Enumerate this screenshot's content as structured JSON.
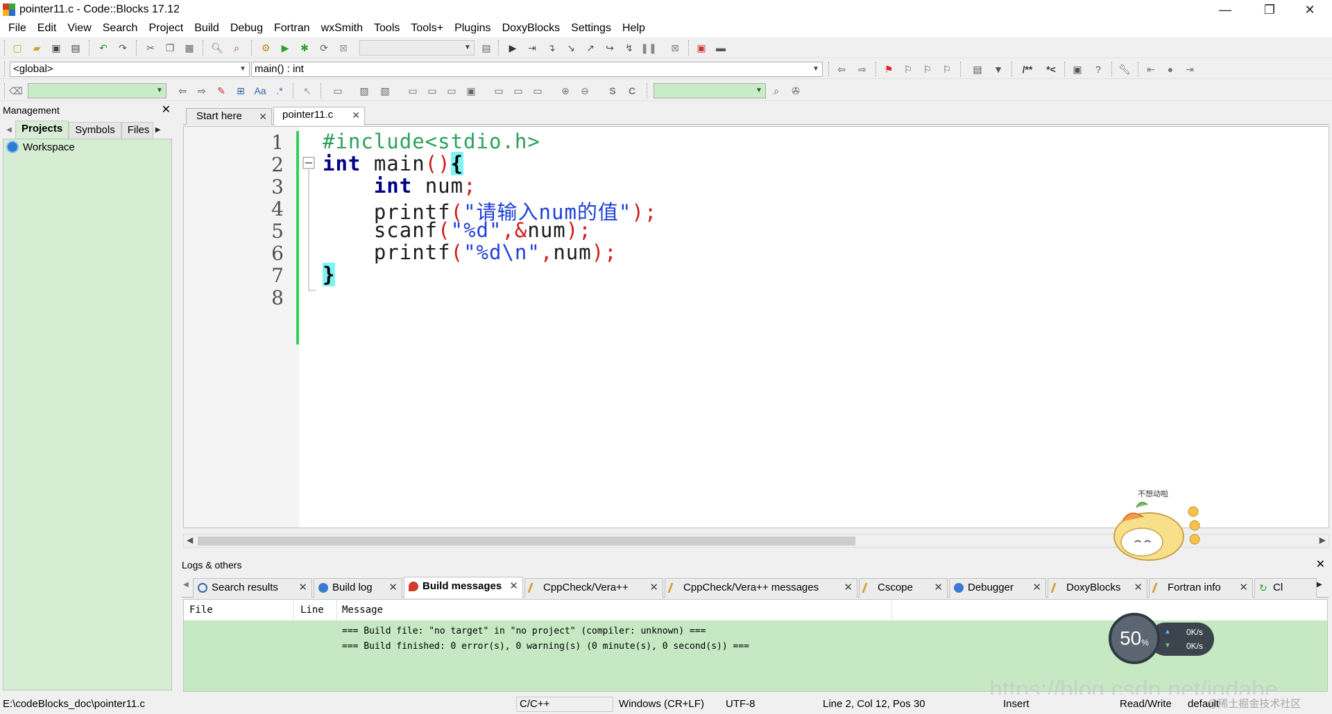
{
  "window": {
    "title": "pointer11.c - Code::Blocks 17.12",
    "controls": {
      "minimize": "—",
      "restore": "❐",
      "close": "✕"
    }
  },
  "menu": [
    "File",
    "Edit",
    "View",
    "Search",
    "Project",
    "Build",
    "Debug",
    "Fortran",
    "wxSmith",
    "Tools",
    "Tools+",
    "Plugins",
    "DoxyBlocks",
    "Settings",
    "Help"
  ],
  "toolbar": {
    "scope_combo": "<global>",
    "function_combo": "main() : int"
  },
  "management": {
    "title": "Management",
    "tabs": [
      "Projects",
      "Symbols",
      "Files"
    ],
    "active_tab": "Projects",
    "tree": [
      "Workspace"
    ]
  },
  "editor": {
    "tabs": [
      {
        "label": "Start here",
        "active": false
      },
      {
        "label": "pointer11.c",
        "active": true
      }
    ],
    "line_numbers": [
      "1",
      "2",
      "3",
      "4",
      "5",
      "6",
      "7",
      "8"
    ],
    "code": {
      "l1": "#include<stdio.h>",
      "l2_kw": "int",
      "l2_id": " main",
      "l2_paren": "()",
      "l2_brace": "{",
      "l3_kw": "int",
      "l3_id": " num",
      "l3_semi": ";",
      "l4_fn": "printf",
      "l4_open": "(",
      "l4_str": "\"请输入num的值\"",
      "l4_close": ");",
      "l5_fn": "scanf",
      "l5_open": "(",
      "l5_str": "\"%d\"",
      "l5_mid": ",&",
      "l5_arg": "num",
      "l5_close": ");",
      "l6_fn": "printf",
      "l6_open": "(",
      "l6_str": "\"%d\\n\"",
      "l6_comma": ",",
      "l6_arg": "num",
      "l6_close": ");",
      "l7_brace": "}"
    }
  },
  "logs": {
    "title": "Logs & others",
    "tabs": [
      {
        "label": "Search results",
        "icon": "search-icon"
      },
      {
        "label": "Build log",
        "icon": "gear-icon"
      },
      {
        "label": "Build messages",
        "icon": "pin-icon",
        "active": true
      },
      {
        "label": "CppCheck/Vera++",
        "icon": "document-icon"
      },
      {
        "label": "CppCheck/Vera++ messages",
        "icon": "document-icon"
      },
      {
        "label": "Cscope",
        "icon": "document-icon"
      },
      {
        "label": "Debugger",
        "icon": "gear-icon"
      },
      {
        "label": "DoxyBlocks",
        "icon": "document-icon"
      },
      {
        "label": "Fortran info",
        "icon": "document-icon"
      },
      {
        "label": "Cl",
        "icon": "arrow-icon"
      }
    ],
    "columns": [
      "File",
      "Line",
      "Message"
    ],
    "messages": [
      "=== Build file: \"no target\" in \"no project\" (compiler: unknown) ===",
      "=== Build finished: 0 error(s), 0 warning(s) (0 minute(s), 0 second(s)) ==="
    ]
  },
  "statusbar": {
    "path": "E:\\codeBlocks_doc\\pointer11.c",
    "language": "C/C++",
    "line_endings": "Windows (CR+LF)",
    "encoding": "UTF-8",
    "position": "Line 2, Col 12, Pos 30",
    "mode": "Insert",
    "access": "Read/Write",
    "profile": "default"
  },
  "overlay": {
    "speed_percent": "50",
    "speed_unit": "%",
    "up_rate": "0K/s",
    "down_rate": "0K/s",
    "mascot_caption": "不想动啦",
    "watermark": "https://blog.csdn.net/jqdabe",
    "watermark_site": "@稀土掘金技术社区"
  },
  "colors": {
    "panel_green": "#c6e8c3",
    "change_bar": "#2ed35b",
    "keyword": "#00008b",
    "preprocessor": "#2aa05a",
    "string": "#1e3fd6",
    "operator": "#d11a1a",
    "brace_match": "#7ff3f3"
  }
}
